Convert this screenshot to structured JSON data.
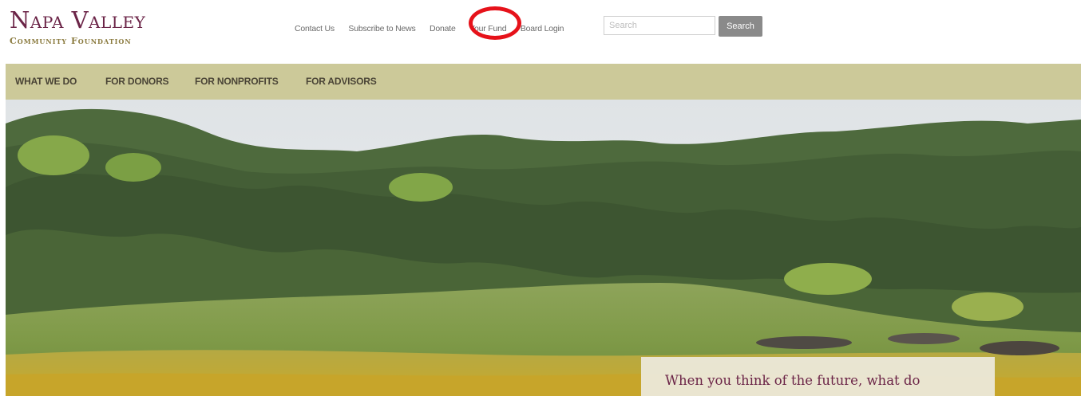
{
  "logo": {
    "line1": "Napa Valley",
    "line2": "Community Foundation"
  },
  "utility_nav": {
    "items": [
      "Contact Us",
      "Subscribe to News",
      "Donate",
      "Your Fund",
      "Board Login"
    ],
    "highlighted": "Your Fund"
  },
  "search": {
    "placeholder": "Search",
    "button_label": "Search"
  },
  "main_nav": {
    "items": [
      "WHAT WE DO",
      "FOR DONORS",
      "FOR NONPROFITS",
      "FOR ADVISORS"
    ]
  },
  "hero": {
    "quote": "When you think of the future, what do"
  },
  "colors": {
    "brand_maroon": "#6b2447",
    "brand_gold": "#8a7a3e",
    "nav_bar": "#ccc999",
    "highlight_circle": "#e6121a",
    "search_button": "#8a8a8a"
  }
}
